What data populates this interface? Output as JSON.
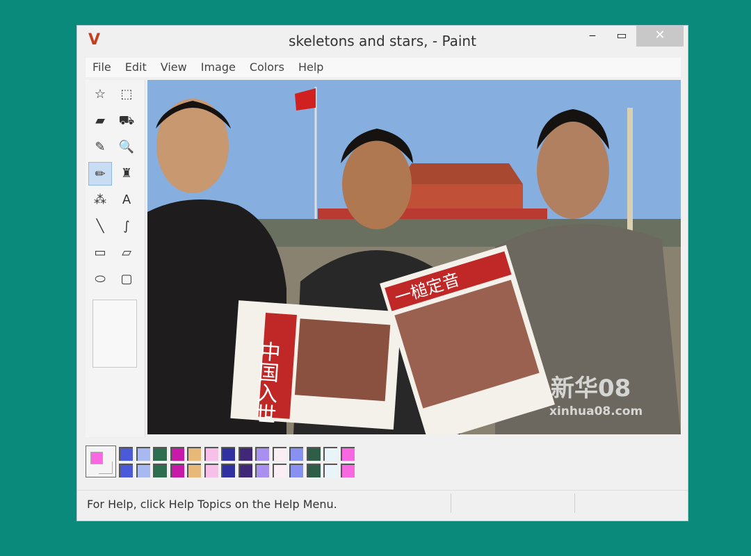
{
  "window": {
    "title": "skeletons and stars, - Paint",
    "minimize": "‒",
    "maximize": "▭",
    "close": "✕"
  },
  "menu": [
    "File",
    "Edit",
    "View",
    "Image",
    "Colors",
    "Help"
  ],
  "tools": [
    {
      "name": "free-form-select",
      "glyph": "☆"
    },
    {
      "name": "select",
      "glyph": "⬚"
    },
    {
      "name": "eraser",
      "glyph": "▰"
    },
    {
      "name": "fill-with-color",
      "glyph": "⛟"
    },
    {
      "name": "pick-color",
      "glyph": "✎"
    },
    {
      "name": "magnifier",
      "glyph": "🔍"
    },
    {
      "name": "pencil",
      "glyph": "✏",
      "selected": true
    },
    {
      "name": "brush",
      "glyph": "♜"
    },
    {
      "name": "airbrush",
      "glyph": "⁂"
    },
    {
      "name": "text",
      "glyph": "A"
    },
    {
      "name": "line",
      "glyph": "╲"
    },
    {
      "name": "curve",
      "glyph": "∫"
    },
    {
      "name": "rectangle",
      "glyph": "▭"
    },
    {
      "name": "polygon",
      "glyph": "▱"
    },
    {
      "name": "ellipse",
      "glyph": "⬭"
    },
    {
      "name": "rounded-rectangle",
      "glyph": "▢"
    }
  ],
  "palette": {
    "foreground": "#f868e0",
    "background": "#f4f4f4",
    "colors": [
      "#4a5ad8",
      "#a8b8f0",
      "#2e6e50",
      "#c81aa8",
      "#e8b878",
      "#f8c0e8",
      "#3030a0",
      "#402878",
      "#a890f0",
      "#f8eef4",
      "#8890f0",
      "#2e5e48",
      "#e8f4f8",
      "#f868e0"
    ]
  },
  "photo": {
    "newspaper_left": "中国入世",
    "newspaper_right": "一槌定音",
    "watermark": "新华08",
    "watermark_url": "xinhua08.com"
  },
  "status": {
    "text": "For Help, click Help Topics on the Help Menu."
  }
}
